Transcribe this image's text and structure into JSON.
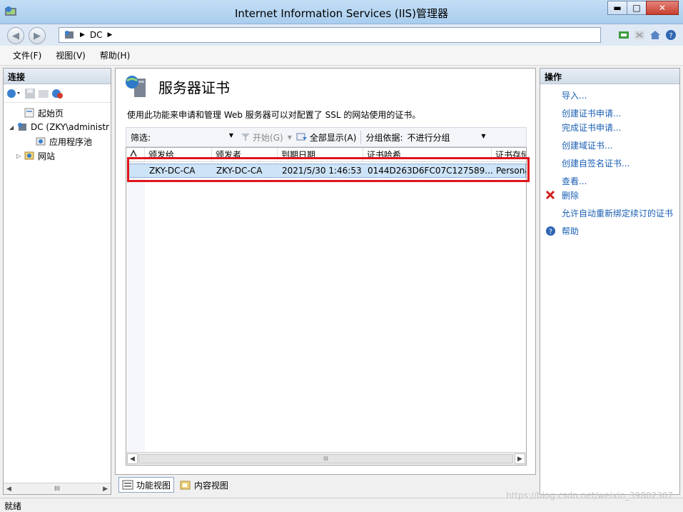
{
  "window": {
    "title": "Internet Information Services (IIS)管理器",
    "min": "▬",
    "max": "□",
    "close": "✕",
    "colors": {
      "titlebar": "#b7d5f2",
      "link": "#1a5fb4",
      "highlight": "#e0141c"
    }
  },
  "nav": {
    "back": "◀",
    "forward": "▶",
    "path": [
      "DC"
    ],
    "sep": "▶",
    "icons": [
      "network-icon",
      "stop-icon",
      "home-icon",
      "help-icon"
    ]
  },
  "menu": [
    "文件(F)",
    "视图(V)",
    "帮助(H)"
  ],
  "connections": {
    "header": "连接",
    "tree": [
      {
        "label": "起始页",
        "icon": "start-page-icon",
        "depth": 1
      },
      {
        "label": "DC (ZKY\\administr",
        "icon": "server-icon",
        "depth": 0,
        "expander": "◢"
      },
      {
        "label": "应用程序池",
        "icon": "app-pool-icon",
        "depth": 2
      },
      {
        "label": "网站",
        "icon": "sites-icon",
        "depth": 1,
        "expander": "▷"
      }
    ],
    "scroll_thumb": "III"
  },
  "main": {
    "title": "服务器证书",
    "description": "使用此功能来申请和管理 Web 服务器可以对配置了 SSL 的网站使用的证书。",
    "filter": {
      "label": "筛选:",
      "go": "开始(G)",
      "show_all": "全部显示(A)",
      "group_by_label": "分组依据:",
      "group_by_value": "不进行分组"
    },
    "columns": [
      "颁发给",
      "颁发者",
      "到期日期",
      "证书哈希",
      "证书存储"
    ],
    "rows": [
      [
        "ZKY-DC-CA",
        "ZKY-DC-CA",
        "2021/5/30 1:46:53",
        "0144D263D6FC07C127589...",
        "Personal"
      ]
    ],
    "scroll_thumb": "III"
  },
  "view_tabs": [
    "功能视图",
    "内容视图"
  ],
  "actions": {
    "header": "操作",
    "items": [
      {
        "label": "导入..."
      },
      {
        "label": "创建证书申请..."
      },
      {
        "label": "完成证书申请..."
      },
      {
        "label": "创建域证书..."
      },
      {
        "label": "创建自签名证书..."
      },
      {
        "label": "查看..."
      },
      {
        "label": "删除",
        "icon": "delete-icon"
      },
      {
        "label": "允许自动重新绑定续订的证书"
      },
      {
        "label": "帮助",
        "icon": "help-icon"
      }
    ]
  },
  "status": "就绪",
  "watermark": "https://blog.csdn.net/weixin_39802307"
}
